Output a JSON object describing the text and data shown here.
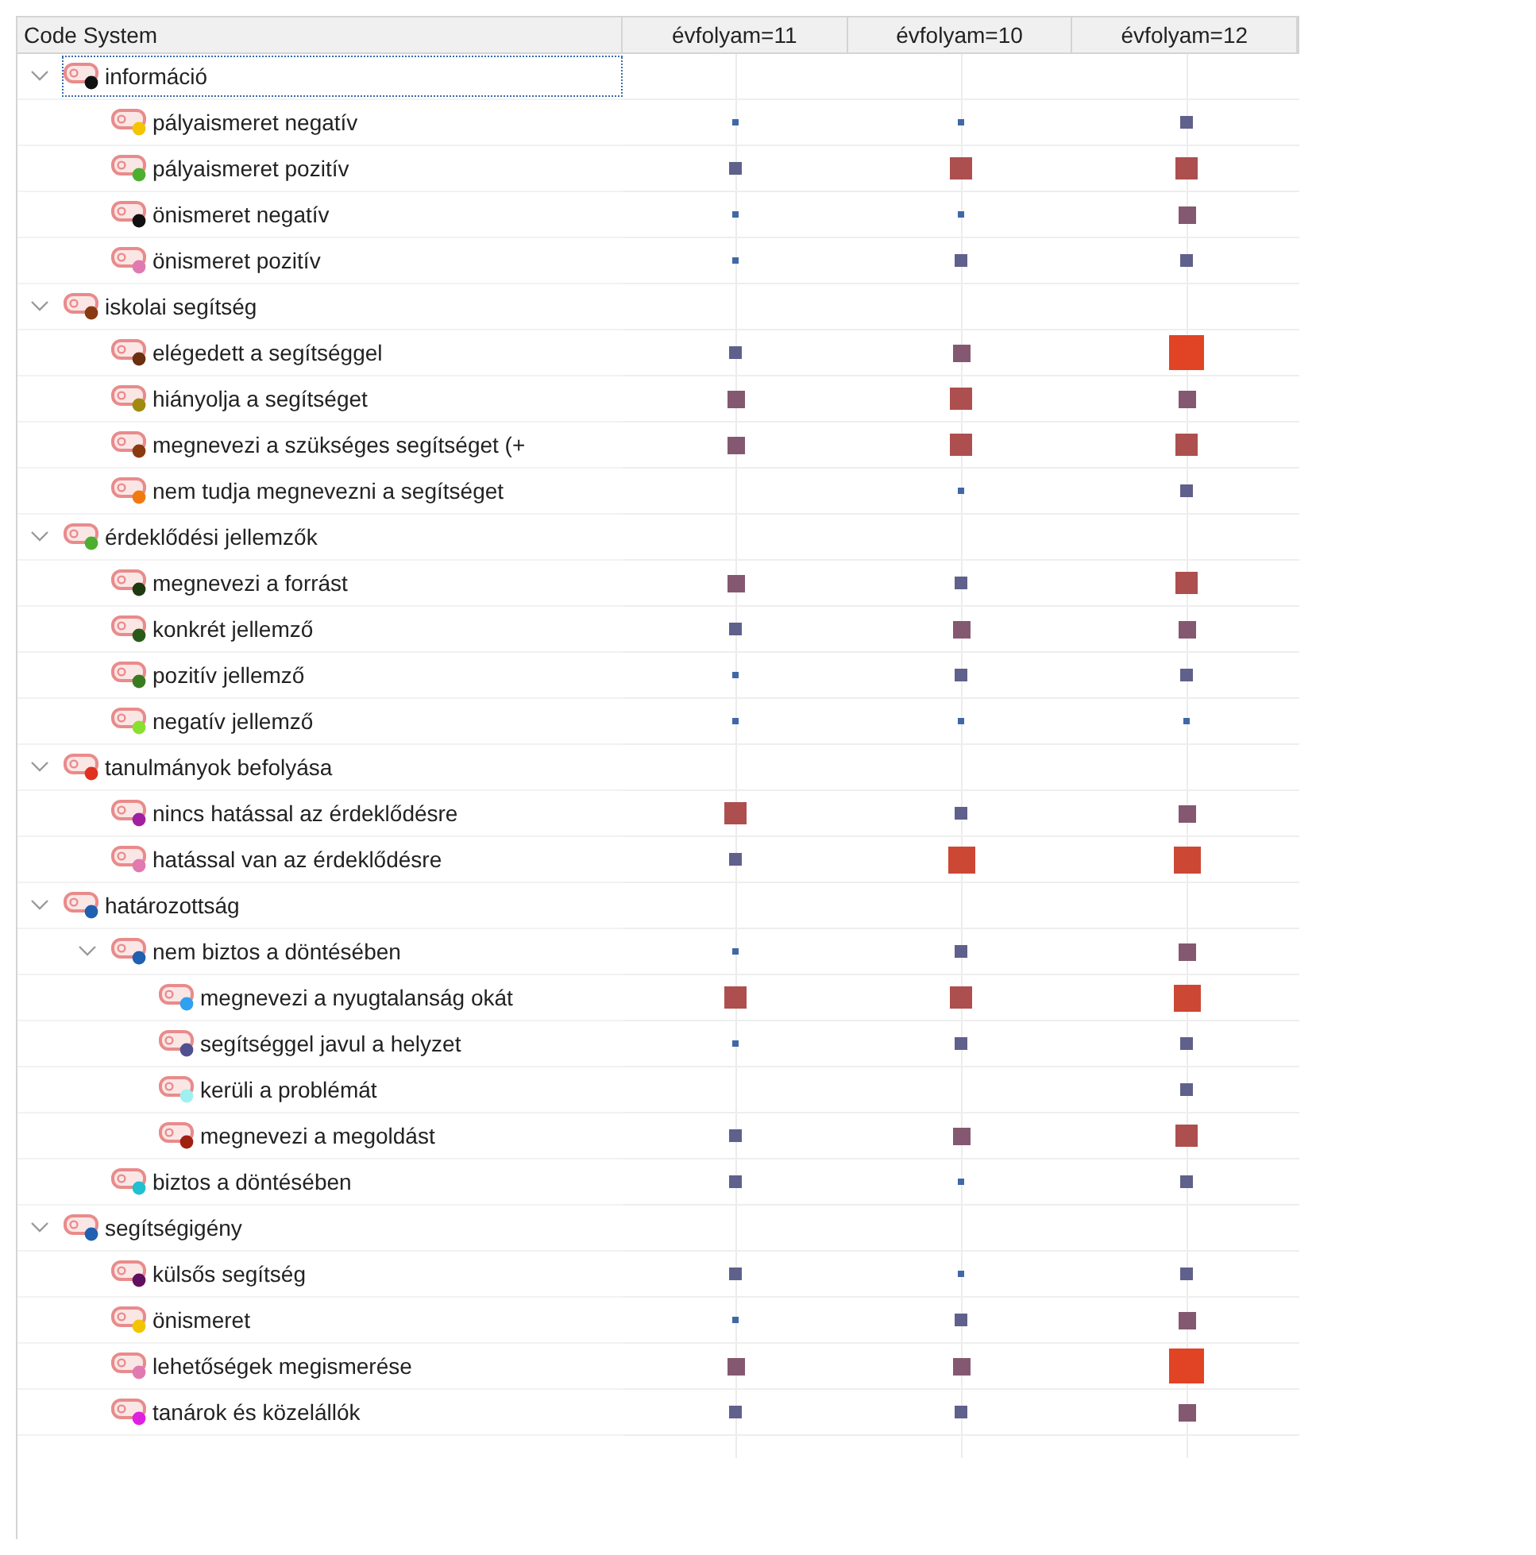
{
  "columns": [
    "Code System",
    "évfolyam=11",
    "évfolyam=10",
    "évfolyam=12"
  ],
  "codes": [
    {
      "name": "információ",
      "color": "#111111",
      "expanded": true,
      "selected": true,
      "children": [
        {
          "name": "pályaismeret negatív",
          "color": "#f2c500",
          "selected": false,
          "cells": [
            {
              "kind": "tiny"
            },
            {
              "kind": "tiny"
            },
            {
              "kind": "small"
            }
          ]
        },
        {
          "name": "pályaismeret pozitív",
          "color": "#4caf30",
          "selected": false,
          "cells": [
            {
              "kind": "small"
            },
            {
              "kind": "large"
            },
            {
              "kind": "large"
            }
          ]
        },
        {
          "name": "önismeret negatív",
          "color": "#111111",
          "selected": false,
          "cells": [
            {
              "kind": "tiny"
            },
            {
              "kind": "tiny"
            },
            {
              "kind": "medium"
            }
          ]
        },
        {
          "name": "önismeret pozitív",
          "color": "#e07ab0",
          "selected": false,
          "cells": [
            {
              "kind": "tiny"
            },
            {
              "kind": "small"
            },
            {
              "kind": "small"
            }
          ]
        }
      ]
    },
    {
      "name": "iskolai segítség",
      "color": "#8a3a10",
      "expanded": true,
      "selected": false,
      "children": [
        {
          "name": "elégedett a segítséggel",
          "color": "#6a3010",
          "selected": false,
          "cells": [
            {
              "kind": "small"
            },
            {
              "kind": "medium"
            },
            {
              "kind": "huge"
            }
          ]
        },
        {
          "name": "hiányolja a segítséget",
          "color": "#a08a10",
          "selected": false,
          "cells": [
            {
              "kind": "medium"
            },
            {
              "kind": "large"
            },
            {
              "kind": "medium"
            }
          ]
        },
        {
          "name": "megnevezi a szükséges segítséget (+",
          "color": "#8a3a10",
          "selected": false,
          "cells": [
            {
              "kind": "medium"
            },
            {
              "kind": "large"
            },
            {
              "kind": "large"
            }
          ]
        },
        {
          "name": "nem tudja megnevezni a segítséget",
          "color": "#f07a10",
          "selected": false,
          "cells": [
            {
              "kind": "empty"
            },
            {
              "kind": "tiny"
            },
            {
              "kind": "small"
            }
          ]
        }
      ]
    },
    {
      "name": "érdeklődési jellemzők",
      "color": "#4caf30",
      "expanded": true,
      "selected": false,
      "children": [
        {
          "name": "megnevezi a forrást",
          "color": "#1f3a10",
          "selected": false,
          "cells": [
            {
              "kind": "medium"
            },
            {
              "kind": "small"
            },
            {
              "kind": "large"
            }
          ]
        },
        {
          "name": "konkrét jellemző",
          "color": "#2a5a1a",
          "selected": false,
          "cells": [
            {
              "kind": "small"
            },
            {
              "kind": "medium"
            },
            {
              "kind": "medium"
            }
          ]
        },
        {
          "name": "pozitív jellemző",
          "color": "#3a7a20",
          "selected": false,
          "cells": [
            {
              "kind": "tiny"
            },
            {
              "kind": "small"
            },
            {
              "kind": "small"
            }
          ]
        },
        {
          "name": "negatív jellemző",
          "color": "#8ae030",
          "selected": false,
          "cells": [
            {
              "kind": "tiny"
            },
            {
              "kind": "tiny"
            },
            {
              "kind": "tiny"
            }
          ]
        }
      ]
    },
    {
      "name": "tanulmányok befolyása",
      "color": "#e03020",
      "expanded": true,
      "selected": false,
      "children": [
        {
          "name": "nincs hatással az érdeklődésre",
          "color": "#a020a0",
          "selected": false,
          "cells": [
            {
              "kind": "large"
            },
            {
              "kind": "small"
            },
            {
              "kind": "medium"
            }
          ]
        },
        {
          "name": "hatással van az érdeklődésre",
          "color": "#e07ab0",
          "selected": false,
          "cells": [
            {
              "kind": "small"
            },
            {
              "kind": "xlarge"
            },
            {
              "kind": "xlarge"
            }
          ]
        }
      ]
    },
    {
      "name": "határozottság",
      "color": "#2060b0",
      "expanded": true,
      "selected": false,
      "children": [
        {
          "name": "nem biztos a döntésében",
          "color": "#2060b0",
          "expanded": true,
          "selected": false,
          "cells": [
            {
              "kind": "tiny"
            },
            {
              "kind": "small"
            },
            {
              "kind": "medium"
            }
          ],
          "children": [
            {
              "name": "megnevezi a nyugtalanság okát",
              "color": "#30a0f0",
              "selected": false,
              "cells": [
                {
                  "kind": "large"
                },
                {
                  "kind": "large"
                },
                {
                  "kind": "xlarge"
                }
              ]
            },
            {
              "name": "segítséggel javul a helyzet",
              "color": "#505090",
              "selected": false,
              "cells": [
                {
                  "kind": "tiny"
                },
                {
                  "kind": "small"
                },
                {
                  "kind": "small"
                }
              ]
            },
            {
              "name": "kerüli a problémát",
              "color": "#a0f0f0",
              "selected": false,
              "cells": [
                {
                  "kind": "empty"
                },
                {
                  "kind": "empty"
                },
                {
                  "kind": "small"
                }
              ]
            },
            {
              "name": "megnevezi a megoldást",
              "color": "#a02010",
              "selected": false,
              "cells": [
                {
                  "kind": "small"
                },
                {
                  "kind": "medium"
                },
                {
                  "kind": "large"
                }
              ]
            }
          ]
        },
        {
          "name": "biztos a döntésében",
          "color": "#20c0d0",
          "selected": false,
          "cells": [
            {
              "kind": "small"
            },
            {
              "kind": "tiny"
            },
            {
              "kind": "small"
            }
          ]
        }
      ]
    },
    {
      "name": "segítségigény",
      "color": "#2060b0",
      "expanded": true,
      "selected": false,
      "children": [
        {
          "name": "külsős segítség",
          "color": "#601060",
          "selected": false,
          "cells": [
            {
              "kind": "small"
            },
            {
              "kind": "tiny"
            },
            {
              "kind": "small"
            }
          ]
        },
        {
          "name": "önismeret",
          "color": "#f2c500",
          "selected": false,
          "cells": [
            {
              "kind": "tiny"
            },
            {
              "kind": "small"
            },
            {
              "kind": "medium"
            }
          ]
        },
        {
          "name": "lehetőségek megismerése",
          "color": "#e07ab0",
          "selected": false,
          "cells": [
            {
              "kind": "medium"
            },
            {
              "kind": "medium"
            },
            {
              "kind": "huge"
            }
          ]
        },
        {
          "name": "tanárok és közelállók",
          "color": "#e020e0",
          "selected": false,
          "cells": [
            {
              "kind": "small"
            },
            {
              "kind": "small"
            },
            {
              "kind": "medium"
            }
          ]
        }
      ]
    }
  ]
}
